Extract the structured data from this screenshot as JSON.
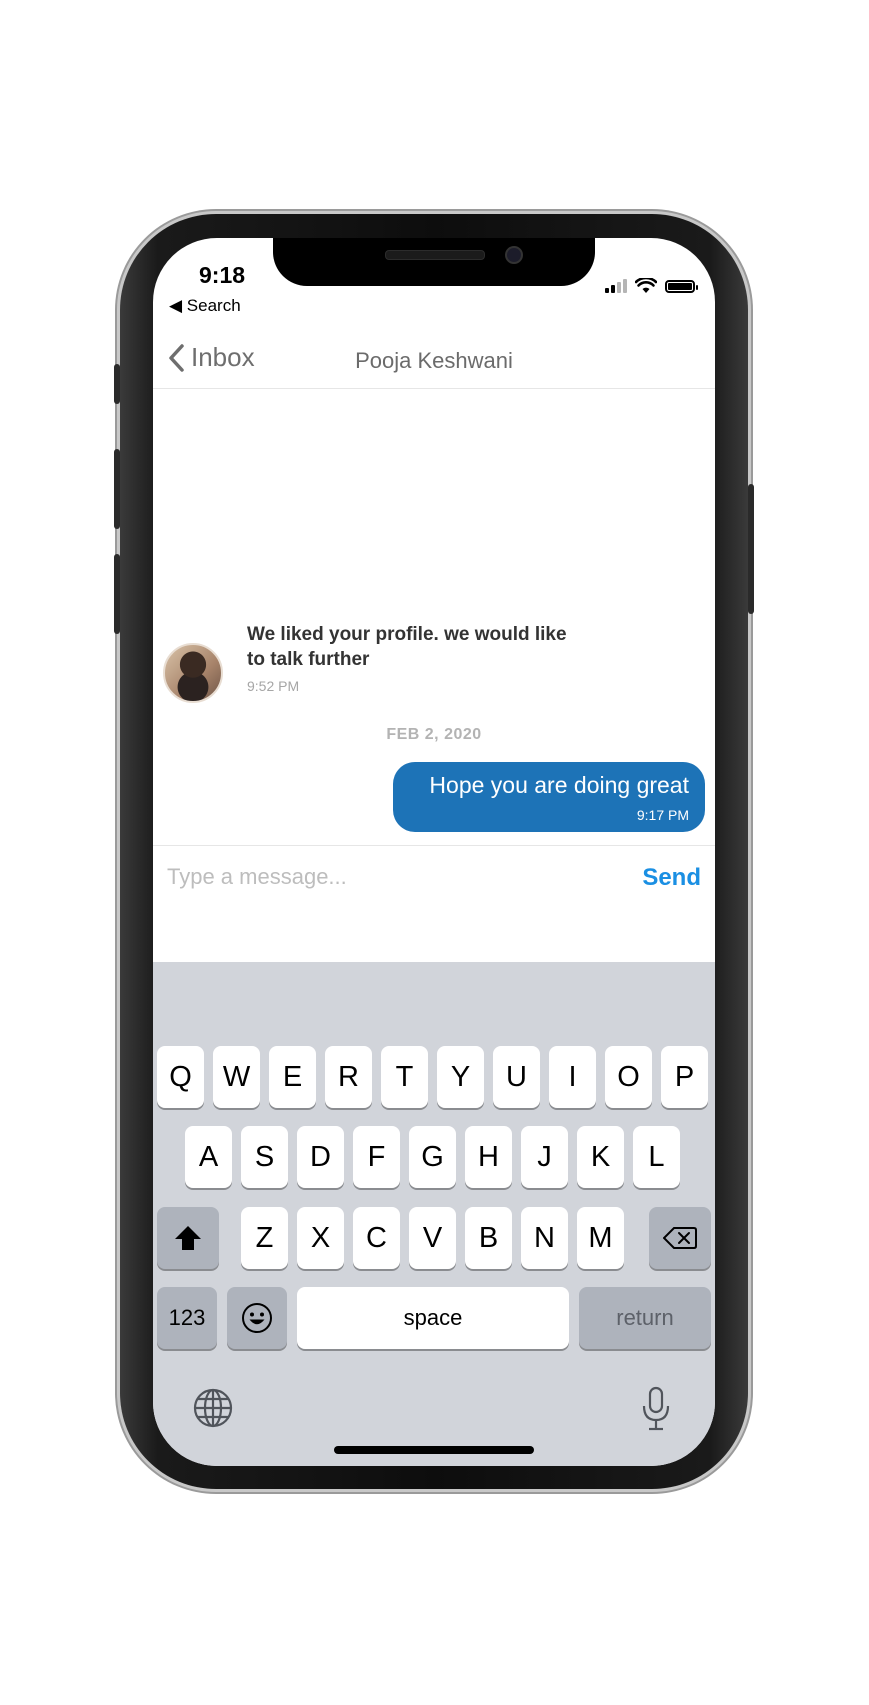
{
  "status_bar": {
    "time": "9:18",
    "back_app": "◀ Search"
  },
  "navbar": {
    "back_label": "Inbox",
    "title": "Pooja Keshwani"
  },
  "conversation": {
    "incoming": {
      "text": "We liked your profile. we would like to talk further",
      "time": "9:52 PM"
    },
    "date_separator": "FEB 2, 2020",
    "outgoing": {
      "text": "Hope you are doing great",
      "time": "9:17 PM",
      "color": "#1d73b7"
    }
  },
  "composer": {
    "placeholder": "Type a message...",
    "value": "",
    "send_label": "Send",
    "send_color": "#1a8fe3"
  },
  "keyboard": {
    "row1": [
      "Q",
      "W",
      "E",
      "R",
      "T",
      "Y",
      "U",
      "I",
      "O",
      "P"
    ],
    "row2": [
      "A",
      "S",
      "D",
      "F",
      "G",
      "H",
      "J",
      "K",
      "L"
    ],
    "row3": [
      "Z",
      "X",
      "C",
      "V",
      "B",
      "N",
      "M"
    ],
    "numbers_label": "123",
    "space_label": "space",
    "return_label": "return",
    "icons": [
      "shift-icon",
      "backspace-icon",
      "emoji-icon",
      "globe-icon",
      "microphone-icon"
    ]
  }
}
